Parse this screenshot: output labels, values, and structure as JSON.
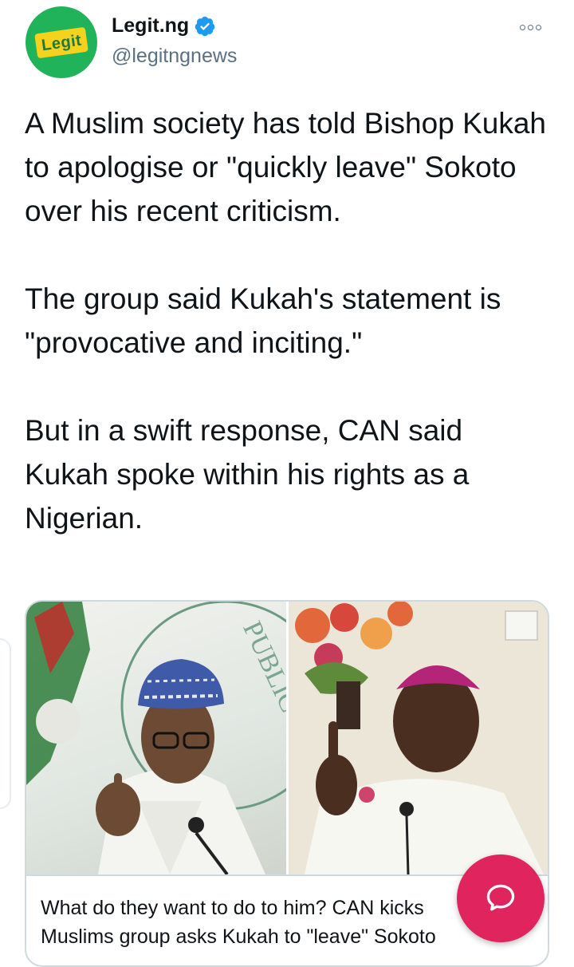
{
  "header": {
    "avatar_logo_text": "Legit",
    "display_name": "Legit.ng",
    "handle": "@legitngnews",
    "verified": true,
    "more_icon": "more-horizontal-icon"
  },
  "tweet": {
    "text": "A Muslim society has told Bishop Kukah to apologise or \"quickly leave\" Sokoto over his recent criticism.\n\nThe group said Kukah's statement is \"provocative and inciting.\"\n\nBut in a swift response, CAN said Kukah spoke within his rights as a Nigerian."
  },
  "card": {
    "image_left_watermark": "PUBLIC",
    "caption_line1": "What do they want to do to him? CAN kicks",
    "caption_line2": "Muslims group asks Kukah to \"leave\" Sokoto"
  },
  "fab": {
    "icon": "compose-reply-icon",
    "color": "#e0245e"
  },
  "colors": {
    "brand_green": "#21b35a",
    "brand_yellow": "#f6d21c",
    "verified_blue": "#1d9bf0",
    "secondary_text": "#5b7083"
  }
}
